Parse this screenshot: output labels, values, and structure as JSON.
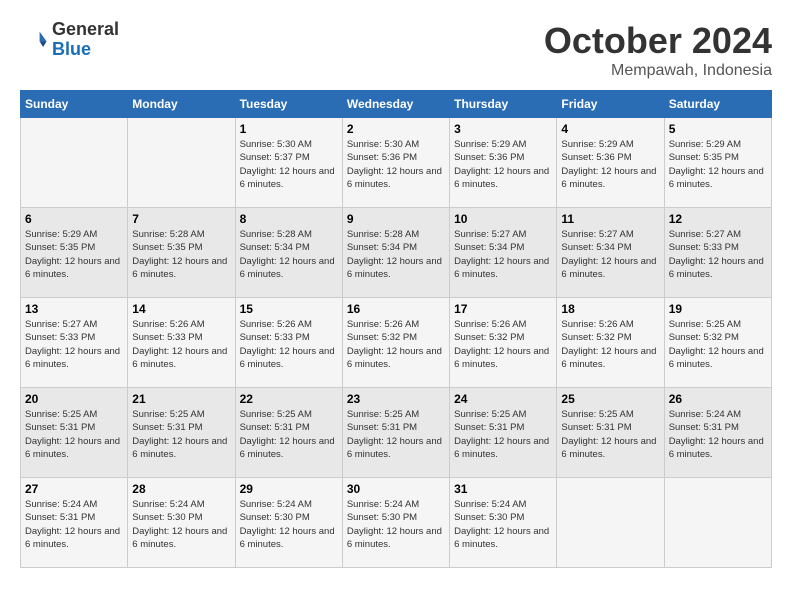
{
  "header": {
    "logo_line1": "General",
    "logo_line2": "Blue",
    "month_title": "October 2024",
    "subtitle": "Mempawah, Indonesia"
  },
  "days_of_week": [
    "Sunday",
    "Monday",
    "Tuesday",
    "Wednesday",
    "Thursday",
    "Friday",
    "Saturday"
  ],
  "weeks": [
    [
      {
        "day": "",
        "info": ""
      },
      {
        "day": "",
        "info": ""
      },
      {
        "day": "1",
        "sunrise": "Sunrise: 5:30 AM",
        "sunset": "Sunset: 5:37 PM",
        "daylight": "Daylight: 12 hours and 6 minutes."
      },
      {
        "day": "2",
        "sunrise": "Sunrise: 5:30 AM",
        "sunset": "Sunset: 5:36 PM",
        "daylight": "Daylight: 12 hours and 6 minutes."
      },
      {
        "day": "3",
        "sunrise": "Sunrise: 5:29 AM",
        "sunset": "Sunset: 5:36 PM",
        "daylight": "Daylight: 12 hours and 6 minutes."
      },
      {
        "day": "4",
        "sunrise": "Sunrise: 5:29 AM",
        "sunset": "Sunset: 5:36 PM",
        "daylight": "Daylight: 12 hours and 6 minutes."
      },
      {
        "day": "5",
        "sunrise": "Sunrise: 5:29 AM",
        "sunset": "Sunset: 5:35 PM",
        "daylight": "Daylight: 12 hours and 6 minutes."
      }
    ],
    [
      {
        "day": "6",
        "sunrise": "Sunrise: 5:29 AM",
        "sunset": "Sunset: 5:35 PM",
        "daylight": "Daylight: 12 hours and 6 minutes."
      },
      {
        "day": "7",
        "sunrise": "Sunrise: 5:28 AM",
        "sunset": "Sunset: 5:35 PM",
        "daylight": "Daylight: 12 hours and 6 minutes."
      },
      {
        "day": "8",
        "sunrise": "Sunrise: 5:28 AM",
        "sunset": "Sunset: 5:34 PM",
        "daylight": "Daylight: 12 hours and 6 minutes."
      },
      {
        "day": "9",
        "sunrise": "Sunrise: 5:28 AM",
        "sunset": "Sunset: 5:34 PM",
        "daylight": "Daylight: 12 hours and 6 minutes."
      },
      {
        "day": "10",
        "sunrise": "Sunrise: 5:27 AM",
        "sunset": "Sunset: 5:34 PM",
        "daylight": "Daylight: 12 hours and 6 minutes."
      },
      {
        "day": "11",
        "sunrise": "Sunrise: 5:27 AM",
        "sunset": "Sunset: 5:34 PM",
        "daylight": "Daylight: 12 hours and 6 minutes."
      },
      {
        "day": "12",
        "sunrise": "Sunrise: 5:27 AM",
        "sunset": "Sunset: 5:33 PM",
        "daylight": "Daylight: 12 hours and 6 minutes."
      }
    ],
    [
      {
        "day": "13",
        "sunrise": "Sunrise: 5:27 AM",
        "sunset": "Sunset: 5:33 PM",
        "daylight": "Daylight: 12 hours and 6 minutes."
      },
      {
        "day": "14",
        "sunrise": "Sunrise: 5:26 AM",
        "sunset": "Sunset: 5:33 PM",
        "daylight": "Daylight: 12 hours and 6 minutes."
      },
      {
        "day": "15",
        "sunrise": "Sunrise: 5:26 AM",
        "sunset": "Sunset: 5:33 PM",
        "daylight": "Daylight: 12 hours and 6 minutes."
      },
      {
        "day": "16",
        "sunrise": "Sunrise: 5:26 AM",
        "sunset": "Sunset: 5:32 PM",
        "daylight": "Daylight: 12 hours and 6 minutes."
      },
      {
        "day": "17",
        "sunrise": "Sunrise: 5:26 AM",
        "sunset": "Sunset: 5:32 PM",
        "daylight": "Daylight: 12 hours and 6 minutes."
      },
      {
        "day": "18",
        "sunrise": "Sunrise: 5:26 AM",
        "sunset": "Sunset: 5:32 PM",
        "daylight": "Daylight: 12 hours and 6 minutes."
      },
      {
        "day": "19",
        "sunrise": "Sunrise: 5:25 AM",
        "sunset": "Sunset: 5:32 PM",
        "daylight": "Daylight: 12 hours and 6 minutes."
      }
    ],
    [
      {
        "day": "20",
        "sunrise": "Sunrise: 5:25 AM",
        "sunset": "Sunset: 5:31 PM",
        "daylight": "Daylight: 12 hours and 6 minutes."
      },
      {
        "day": "21",
        "sunrise": "Sunrise: 5:25 AM",
        "sunset": "Sunset: 5:31 PM",
        "daylight": "Daylight: 12 hours and 6 minutes."
      },
      {
        "day": "22",
        "sunrise": "Sunrise: 5:25 AM",
        "sunset": "Sunset: 5:31 PM",
        "daylight": "Daylight: 12 hours and 6 minutes."
      },
      {
        "day": "23",
        "sunrise": "Sunrise: 5:25 AM",
        "sunset": "Sunset: 5:31 PM",
        "daylight": "Daylight: 12 hours and 6 minutes."
      },
      {
        "day": "24",
        "sunrise": "Sunrise: 5:25 AM",
        "sunset": "Sunset: 5:31 PM",
        "daylight": "Daylight: 12 hours and 6 minutes."
      },
      {
        "day": "25",
        "sunrise": "Sunrise: 5:25 AM",
        "sunset": "Sunset: 5:31 PM",
        "daylight": "Daylight: 12 hours and 6 minutes."
      },
      {
        "day": "26",
        "sunrise": "Sunrise: 5:24 AM",
        "sunset": "Sunset: 5:31 PM",
        "daylight": "Daylight: 12 hours and 6 minutes."
      }
    ],
    [
      {
        "day": "27",
        "sunrise": "Sunrise: 5:24 AM",
        "sunset": "Sunset: 5:31 PM",
        "daylight": "Daylight: 12 hours and 6 minutes."
      },
      {
        "day": "28",
        "sunrise": "Sunrise: 5:24 AM",
        "sunset": "Sunset: 5:30 PM",
        "daylight": "Daylight: 12 hours and 6 minutes."
      },
      {
        "day": "29",
        "sunrise": "Sunrise: 5:24 AM",
        "sunset": "Sunset: 5:30 PM",
        "daylight": "Daylight: 12 hours and 6 minutes."
      },
      {
        "day": "30",
        "sunrise": "Sunrise: 5:24 AM",
        "sunset": "Sunset: 5:30 PM",
        "daylight": "Daylight: 12 hours and 6 minutes."
      },
      {
        "day": "31",
        "sunrise": "Sunrise: 5:24 AM",
        "sunset": "Sunset: 5:30 PM",
        "daylight": "Daylight: 12 hours and 6 minutes."
      },
      {
        "day": "",
        "info": ""
      },
      {
        "day": "",
        "info": ""
      }
    ]
  ]
}
